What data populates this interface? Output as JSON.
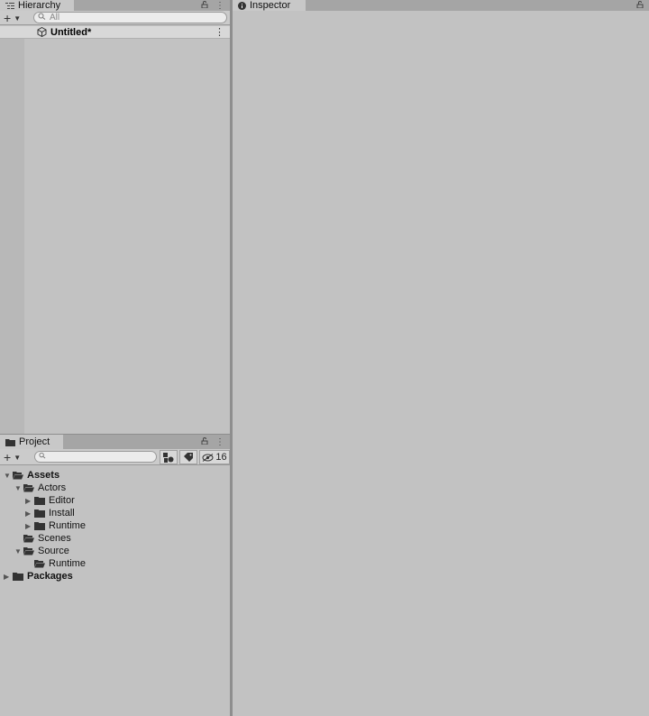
{
  "hierarchy": {
    "tab_label": "Hierarchy",
    "search_placeholder": "All",
    "scene_name": "Untitled*"
  },
  "inspector": {
    "tab_label": "Inspector"
  },
  "project": {
    "tab_label": "Project",
    "hidden_count": "16",
    "tree": [
      {
        "label": "Assets",
        "bold": true,
        "expanded": true
      },
      {
        "label": "Actors",
        "expanded": true
      },
      {
        "label": "Editor",
        "expanded": false
      },
      {
        "label": "Install",
        "expanded": false
      },
      {
        "label": "Runtime",
        "expanded": false
      },
      {
        "label": "Scenes"
      },
      {
        "label": "Source",
        "expanded": true
      },
      {
        "label": "Runtime"
      },
      {
        "label": "Packages",
        "bold": true,
        "expanded": false
      }
    ]
  },
  "icons": {
    "hierarchy": "list-icon",
    "inspector": "info-icon",
    "project": "folder-icon",
    "lock": "lock-icon",
    "menu": "kebab-menu-icon"
  },
  "colors": {
    "panel": "#c2c2c2",
    "tabbar": "#a5a5a5",
    "divider": "#8e8e8e"
  }
}
